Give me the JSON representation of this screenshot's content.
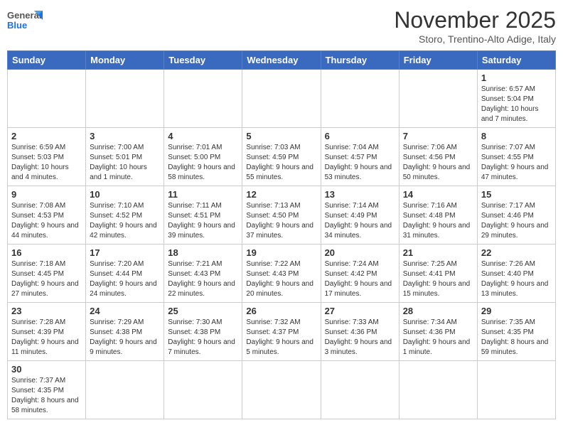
{
  "header": {
    "logo_general": "General",
    "logo_blue": "Blue",
    "title": "November 2025",
    "subtitle": "Storo, Trentino-Alto Adige, Italy"
  },
  "weekdays": [
    "Sunday",
    "Monday",
    "Tuesday",
    "Wednesday",
    "Thursday",
    "Friday",
    "Saturday"
  ],
  "weeks": [
    {
      "days": [
        {
          "num": "",
          "info": ""
        },
        {
          "num": "",
          "info": ""
        },
        {
          "num": "",
          "info": ""
        },
        {
          "num": "",
          "info": ""
        },
        {
          "num": "",
          "info": ""
        },
        {
          "num": "",
          "info": ""
        },
        {
          "num": "1",
          "info": "Sunrise: 6:57 AM\nSunset: 5:04 PM\nDaylight: 10 hours\nand 7 minutes."
        }
      ]
    },
    {
      "days": [
        {
          "num": "2",
          "info": "Sunrise: 6:59 AM\nSunset: 5:03 PM\nDaylight: 10 hours\nand 4 minutes."
        },
        {
          "num": "3",
          "info": "Sunrise: 7:00 AM\nSunset: 5:01 PM\nDaylight: 10 hours\nand 1 minute."
        },
        {
          "num": "4",
          "info": "Sunrise: 7:01 AM\nSunset: 5:00 PM\nDaylight: 9 hours\nand 58 minutes."
        },
        {
          "num": "5",
          "info": "Sunrise: 7:03 AM\nSunset: 4:59 PM\nDaylight: 9 hours\nand 55 minutes."
        },
        {
          "num": "6",
          "info": "Sunrise: 7:04 AM\nSunset: 4:57 PM\nDaylight: 9 hours\nand 53 minutes."
        },
        {
          "num": "7",
          "info": "Sunrise: 7:06 AM\nSunset: 4:56 PM\nDaylight: 9 hours\nand 50 minutes."
        },
        {
          "num": "8",
          "info": "Sunrise: 7:07 AM\nSunset: 4:55 PM\nDaylight: 9 hours\nand 47 minutes."
        }
      ]
    },
    {
      "days": [
        {
          "num": "9",
          "info": "Sunrise: 7:08 AM\nSunset: 4:53 PM\nDaylight: 9 hours\nand 44 minutes."
        },
        {
          "num": "10",
          "info": "Sunrise: 7:10 AM\nSunset: 4:52 PM\nDaylight: 9 hours\nand 42 minutes."
        },
        {
          "num": "11",
          "info": "Sunrise: 7:11 AM\nSunset: 4:51 PM\nDaylight: 9 hours\nand 39 minutes."
        },
        {
          "num": "12",
          "info": "Sunrise: 7:13 AM\nSunset: 4:50 PM\nDaylight: 9 hours\nand 37 minutes."
        },
        {
          "num": "13",
          "info": "Sunrise: 7:14 AM\nSunset: 4:49 PM\nDaylight: 9 hours\nand 34 minutes."
        },
        {
          "num": "14",
          "info": "Sunrise: 7:16 AM\nSunset: 4:48 PM\nDaylight: 9 hours\nand 31 minutes."
        },
        {
          "num": "15",
          "info": "Sunrise: 7:17 AM\nSunset: 4:46 PM\nDaylight: 9 hours\nand 29 minutes."
        }
      ]
    },
    {
      "days": [
        {
          "num": "16",
          "info": "Sunrise: 7:18 AM\nSunset: 4:45 PM\nDaylight: 9 hours\nand 27 minutes."
        },
        {
          "num": "17",
          "info": "Sunrise: 7:20 AM\nSunset: 4:44 PM\nDaylight: 9 hours\nand 24 minutes."
        },
        {
          "num": "18",
          "info": "Sunrise: 7:21 AM\nSunset: 4:43 PM\nDaylight: 9 hours\nand 22 minutes."
        },
        {
          "num": "19",
          "info": "Sunrise: 7:22 AM\nSunset: 4:43 PM\nDaylight: 9 hours\nand 20 minutes."
        },
        {
          "num": "20",
          "info": "Sunrise: 7:24 AM\nSunset: 4:42 PM\nDaylight: 9 hours\nand 17 minutes."
        },
        {
          "num": "21",
          "info": "Sunrise: 7:25 AM\nSunset: 4:41 PM\nDaylight: 9 hours\nand 15 minutes."
        },
        {
          "num": "22",
          "info": "Sunrise: 7:26 AM\nSunset: 4:40 PM\nDaylight: 9 hours\nand 13 minutes."
        }
      ]
    },
    {
      "days": [
        {
          "num": "23",
          "info": "Sunrise: 7:28 AM\nSunset: 4:39 PM\nDaylight: 9 hours\nand 11 minutes."
        },
        {
          "num": "24",
          "info": "Sunrise: 7:29 AM\nSunset: 4:38 PM\nDaylight: 9 hours\nand 9 minutes."
        },
        {
          "num": "25",
          "info": "Sunrise: 7:30 AM\nSunset: 4:38 PM\nDaylight: 9 hours\nand 7 minutes."
        },
        {
          "num": "26",
          "info": "Sunrise: 7:32 AM\nSunset: 4:37 PM\nDaylight: 9 hours\nand 5 minutes."
        },
        {
          "num": "27",
          "info": "Sunrise: 7:33 AM\nSunset: 4:36 PM\nDaylight: 9 hours\nand 3 minutes."
        },
        {
          "num": "28",
          "info": "Sunrise: 7:34 AM\nSunset: 4:36 PM\nDaylight: 9 hours\nand 1 minute."
        },
        {
          "num": "29",
          "info": "Sunrise: 7:35 AM\nSunset: 4:35 PM\nDaylight: 8 hours\nand 59 minutes."
        }
      ]
    },
    {
      "days": [
        {
          "num": "30",
          "info": "Sunrise: 7:37 AM\nSunset: 4:35 PM\nDaylight: 8 hours\nand 58 minutes."
        },
        {
          "num": "",
          "info": ""
        },
        {
          "num": "",
          "info": ""
        },
        {
          "num": "",
          "info": ""
        },
        {
          "num": "",
          "info": ""
        },
        {
          "num": "",
          "info": ""
        },
        {
          "num": "",
          "info": ""
        }
      ]
    }
  ]
}
